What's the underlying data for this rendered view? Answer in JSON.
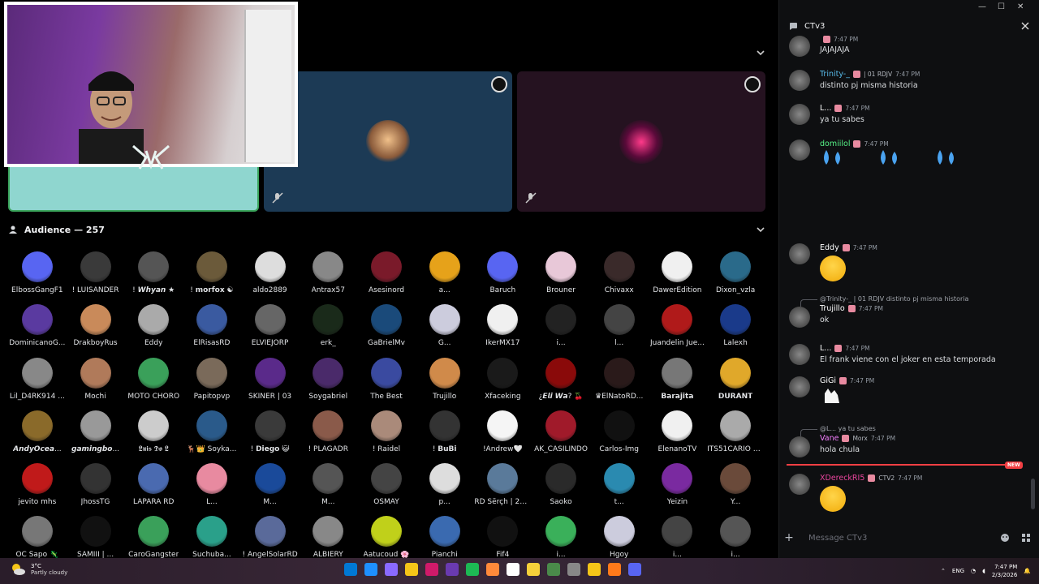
{
  "chat": {
    "title": "CTv3",
    "input_placeholder": "Message CTv3",
    "new_label": "NEW",
    "messages": [
      {
        "user": "",
        "time": "7:47 PM",
        "text": "JAJAJAJA",
        "color": "#dbdee1"
      },
      {
        "user": "Trinity-_",
        "tag": "| 01  RDJV",
        "time": "7:47 PM",
        "text": "distinto pj misma historia",
        "color": "#56b8e6"
      },
      {
        "user": "L...",
        "time": "7:47 PM",
        "text": "ya tu sabes",
        "color": "#ffffff"
      },
      {
        "user": "domiilol",
        "time": "7:47 PM",
        "text": "",
        "color": "#57f287"
      },
      {
        "user": "Eddy",
        "time": "7:47 PM",
        "text": "",
        "color": "#ffffff"
      },
      {
        "reply": "@Trinity-_ | 01  RDJV  distinto pj misma historia",
        "user": "Trujillo",
        "time": "7:47 PM",
        "text": "ok",
        "color": "#ffffff"
      },
      {
        "user": "L...",
        "time": "7:47 PM",
        "text": "El frank viene con el joker en esta temporada",
        "color": "#ffffff"
      },
      {
        "user": "GiGi",
        "time": "7:47 PM",
        "text": "",
        "color": "#ffffff"
      },
      {
        "reply": "@L...  ya tu sabes",
        "user": "Vane",
        "tag": "Morx",
        "time": "7:47 PM",
        "text": "hola chula",
        "color": "#f47fff"
      },
      {
        "user": "XDereckRI5",
        "tag": "CTV2",
        "time": "7:47 PM",
        "text": "",
        "color": "#eb459e"
      }
    ]
  },
  "audience": {
    "title": "Audience — 257",
    "members": [
      {
        "name": "ElbossGangF1",
        "color": "#5865f2"
      },
      {
        "name": "! LUISANDER",
        "color": "#3a3a3a"
      },
      {
        "name": "! 𝙒𝙝𝙮𝙖𝙣 ★",
        "color": "#555"
      },
      {
        "name": "! 𝗺𝗼𝗿𝗳𝗼𝘅 ☯",
        "color": "#6b5a3a"
      },
      {
        "name": "aldo2889",
        "color": "#ddd"
      },
      {
        "name": "Antrax57",
        "color": "#888"
      },
      {
        "name": "Asesinord",
        "color": "#7a1a2a"
      },
      {
        "name": "a...",
        "color": "#e6a21a"
      },
      {
        "name": "Baruch",
        "color": "#5865f2"
      },
      {
        "name": "Brouner",
        "color": "#e8c8d8"
      },
      {
        "name": "Chivaxx",
        "color": "#3a2a2a"
      },
      {
        "name": "DawerEdition",
        "color": "#f0f0f0"
      },
      {
        "name": "Dixon_vzla",
        "color": "#2a6a8a"
      },
      {
        "name": "DominicanoG...",
        "color": "#5a3aa0"
      },
      {
        "name": "DrakboyRus",
        "color": "#c98a5a"
      },
      {
        "name": "Eddy",
        "color": "#aaa"
      },
      {
        "name": "ElRisasRD",
        "color": "#3a5aa0"
      },
      {
        "name": "ELVIEJORP",
        "color": "#666"
      },
      {
        "name": "erk_",
        "color": "#1a2a1a"
      },
      {
        "name": "GaBrielMv",
        "color": "#1a4a7a"
      },
      {
        "name": "G...",
        "color": "#ccd"
      },
      {
        "name": "IkerMX17",
        "color": "#f0f0f0"
      },
      {
        "name": "i...",
        "color": "#222"
      },
      {
        "name": "l...",
        "color": "#444"
      },
      {
        "name": "Juandelin Jue...",
        "color": "#b01a1a"
      },
      {
        "name": "Lalexh",
        "color": "#1a3a8a"
      },
      {
        "name": "Lil_D4RK914 ...",
        "color": "#888"
      },
      {
        "name": "Mochi",
        "color": "#b07a5a"
      },
      {
        "name": "MOTO CHORO",
        "color": "#3aa05a"
      },
      {
        "name": "Papitopvp",
        "color": "#7a6a5a"
      },
      {
        "name": "SKINER | 03",
        "color": "#5a2a8a"
      },
      {
        "name": "Soygabriel",
        "color": "#4a2a6a"
      },
      {
        "name": "The Best",
        "color": "#3a4aa0"
      },
      {
        "name": "Trujillo",
        "color": "#d08a4a"
      },
      {
        "name": "Xfaceking",
        "color": "#1a1a1a"
      },
      {
        "name": "¿𝙀𝙡𝙞 𝙒𝙖? 🍒",
        "color": "#8a0a0a"
      },
      {
        "name": "♛ElNatoRD...",
        "color": "#2a1a1a"
      },
      {
        "name": "𝗕𝗮𝗿𝗮𝗷𝗶𝘁𝗮",
        "color": "#777"
      },
      {
        "name": "𝗗𝗨𝗥𝗔𝗡𝗧",
        "color": "#e0a82a"
      },
      {
        "name": "𝘼𝙣𝙙𝙮𝙊𝙘𝙚𝙖...",
        "color": "#8a6a2a"
      },
      {
        "name": "𝙜𝙖𝙢𝙞𝙣𝙜𝙗𝙤...",
        "color": "#999"
      },
      {
        "name": "𝕷𝖚𝖎𝖘 𝕯𝖔 𝕷",
        "color": "#ccc"
      },
      {
        "name": "🦌👑 Soyka...",
        "color": "#2a5a8a"
      },
      {
        "name": "! 𝗗𝗶𝗲𝗴𝗼 😺",
        "color": "#3a3a3a"
      },
      {
        "name": "! PLAGADR",
        "color": "#8a5a4a"
      },
      {
        "name": "! Raidel",
        "color": "#aa8a7a"
      },
      {
        "name": "! 𝗕𝘂𝗕𝗶",
        "color": "#333"
      },
      {
        "name": "!Andrew🤍",
        "color": "#f5f5f5"
      },
      {
        "name": "AK_CASILINDO",
        "color": "#a01a2a"
      },
      {
        "name": "Carlos-Img",
        "color": "#111"
      },
      {
        "name": "ElenanoTV",
        "color": "#f0f0f0"
      },
      {
        "name": "ITS51CARIO O...",
        "color": "#aaa"
      },
      {
        "name": "jevito mhs",
        "color": "#c01a1a"
      },
      {
        "name": "JhossTG",
        "color": "#333"
      },
      {
        "name": "LAPARA RD",
        "color": "#4a6ab0"
      },
      {
        "name": "L...",
        "color": "#e88aa0"
      },
      {
        "name": "M...",
        "color": "#1a4a9a"
      },
      {
        "name": "M...",
        "color": "#555"
      },
      {
        "name": "OSMAY",
        "color": "#444"
      },
      {
        "name": "p...",
        "color": "#ddd"
      },
      {
        "name": "RD Šërçh | 20 ...",
        "color": "#5a7a9a"
      },
      {
        "name": "Saoko",
        "color": "#2a2a2a"
      },
      {
        "name": "t...",
        "color": "#2a8ab0"
      },
      {
        "name": "Yeizin",
        "color": "#7a2aa0"
      },
      {
        "name": "Y...",
        "color": "#6a4a3a"
      },
      {
        "name": "OC Sapo 🦎",
        "color": "#777"
      },
      {
        "name": "SAMIII | ...",
        "color": "#111"
      },
      {
        "name": "CaroGangster",
        "color": "#3aa05a"
      },
      {
        "name": "Suchuba...",
        "color": "#2aa08a"
      },
      {
        "name": "! AngelSolarRD",
        "color": "#5a6a9a"
      },
      {
        "name": "ALBIERY",
        "color": "#888"
      },
      {
        "name": "Aatucoud 🌸",
        "color": "#c0d01a"
      },
      {
        "name": "Pianchi",
        "color": "#3a6ab0"
      },
      {
        "name": "Fif4",
        "color": "#111"
      },
      {
        "name": "i...",
        "color": "#3ab05a"
      },
      {
        "name": "Hgoy",
        "color": "#ccd"
      },
      {
        "name": "i...",
        "color": "#444"
      },
      {
        "name": "i...",
        "color": "#555"
      }
    ]
  },
  "taskbar": {
    "temp": "3°C",
    "weather": "Partly cloudy",
    "lang": "ENG",
    "time": "7:47 PM",
    "date": "2/3/2026",
    "apps": [
      "#0078d4",
      "#1e90ff",
      "#8a6aff",
      "#f5c518",
      "#d01a6a",
      "#6a3ab0",
      "#1db954",
      "#ff8a3a",
      "#ffffff",
      "#f5d13a",
      "#4a8a4a",
      "#888888",
      "#f5c518",
      "#ff7a1a",
      "#5865f2"
    ]
  },
  "colors": {
    "accent": "#5865f2",
    "speaking": "#3ba55c",
    "new": "#f23f43"
  }
}
